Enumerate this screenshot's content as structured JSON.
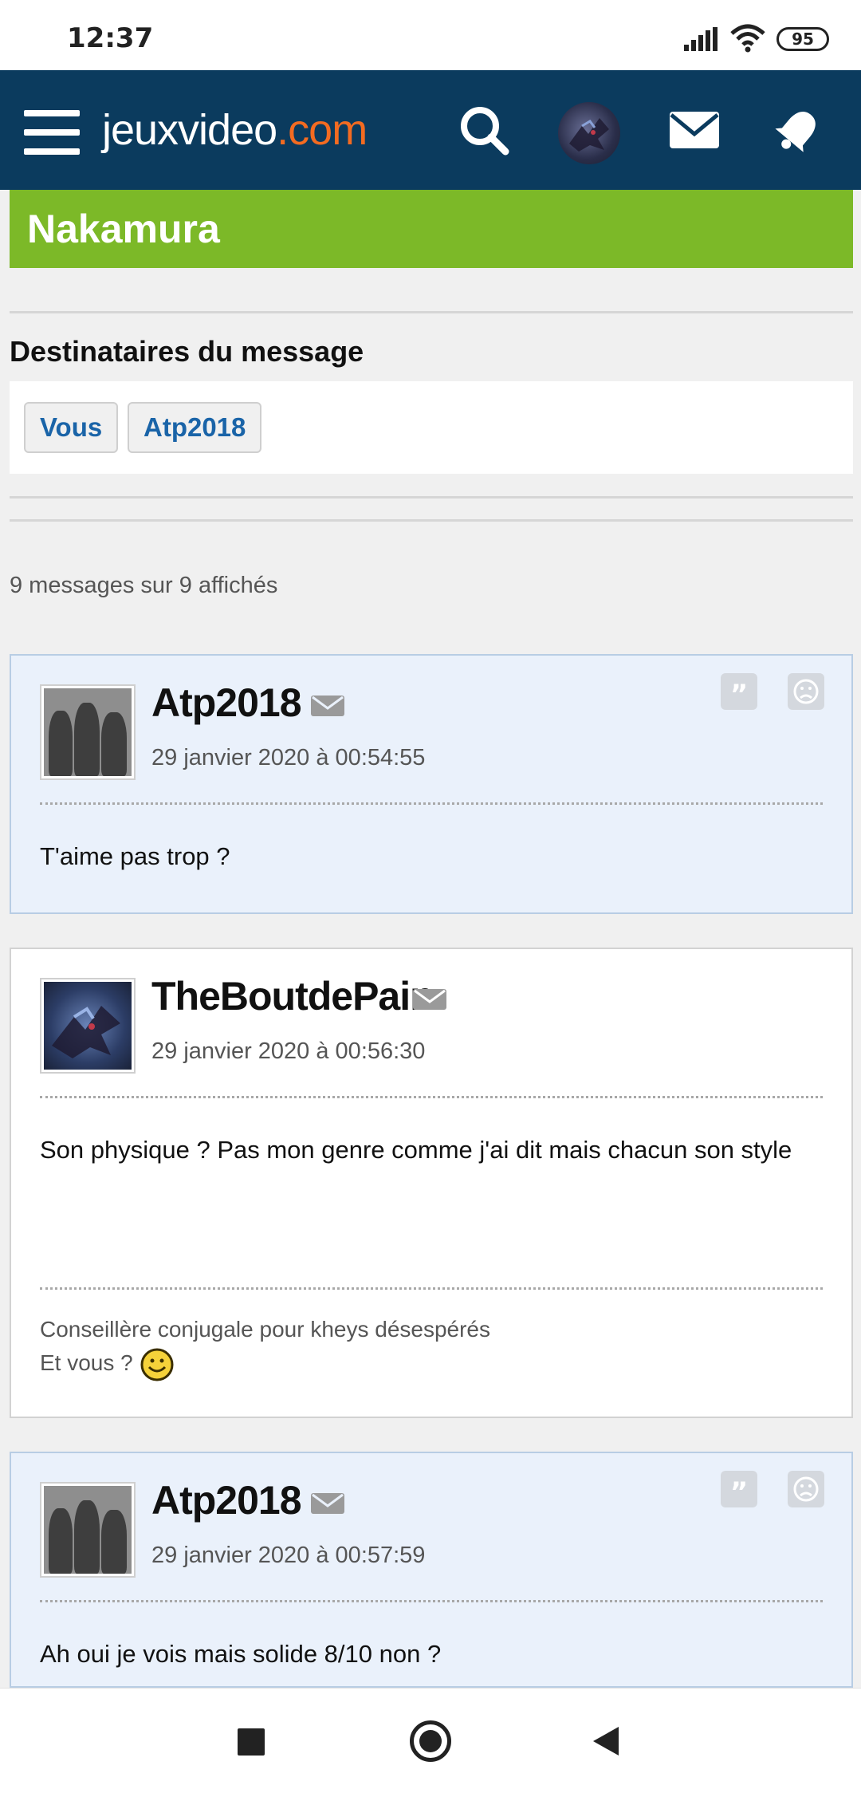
{
  "status": {
    "time": "12:37",
    "battery": "95"
  },
  "header": {
    "logo_main": "jeuxvideo",
    "logo_suffix": ".com"
  },
  "topic": {
    "title": "Nakamura"
  },
  "recipients": {
    "title": "Destinataires du message",
    "chips": [
      "Vous",
      "Atp2018"
    ]
  },
  "count_text": "9 messages sur 9 affichés",
  "messages": [
    {
      "author": "Atp2018",
      "date": "29 janvier 2020 à 00:54:55",
      "body": "T'aime pas trop ?"
    },
    {
      "author": "TheBoutdePain",
      "date": "29 janvier 2020 à 00:56:30",
      "body": "Son physique ? Pas mon genre comme j'ai dit mais chacun son style",
      "signature_line1": "Conseillère conjugale pour kheys désespérés",
      "signature_line2": "Et vous ?"
    },
    {
      "author": "Atp2018",
      "date": "29 janvier 2020 à 00:57:59",
      "body": "Ah oui je vois mais solide 8/10 non ?"
    }
  ],
  "colors": {
    "header_bg": "#0b3b5e",
    "title_bar": "#7cb928",
    "logo_accent": "#f36b21",
    "link": "#1a64a8"
  }
}
